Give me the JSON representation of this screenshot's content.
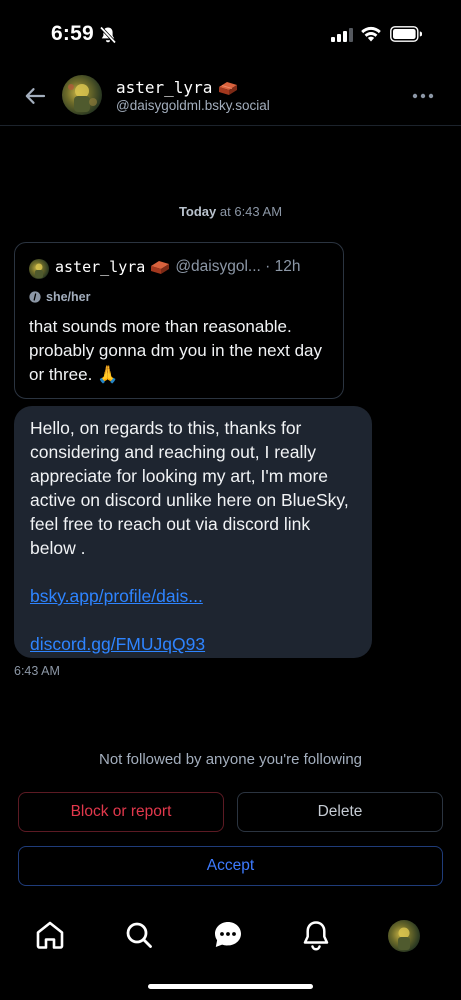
{
  "status_bar": {
    "time": "6:59"
  },
  "header": {
    "name": "aster_lyra",
    "handle": "@daisygoldml.bsky.social",
    "name_emoji": "brick-emoji"
  },
  "divider": {
    "day": "Today",
    "time": "at 6:43 AM"
  },
  "embed_post": {
    "name": "aster_lyra",
    "handle": "@daisygol... · 12h",
    "pronouns": "she/her",
    "text": "that sounds more than reasonable. probably gonna dm you in the next day or three. 🙏"
  },
  "message": {
    "text": "Hello, on regards to this, thanks for considering and reaching out, I really appreciate for looking my art, I'm more active on discord unlike here on BlueSky, feel free to reach out via discord link below .",
    "link1": "bsky.app/profile/dais...",
    "link2": "discord.gg/FMUJqQ93",
    "time": "6:43 AM"
  },
  "request": {
    "notice": "Not followed by anyone you're following",
    "block_label": "Block or report",
    "delete_label": "Delete",
    "accept_label": "Accept"
  },
  "colors": {
    "accent": "#2e84ff",
    "danger": "#e2384c",
    "bubble": "#1e2530"
  },
  "nav": {
    "items": [
      "home-icon",
      "search-icon",
      "chat-icon",
      "notifications-icon",
      "profile-avatar"
    ]
  }
}
